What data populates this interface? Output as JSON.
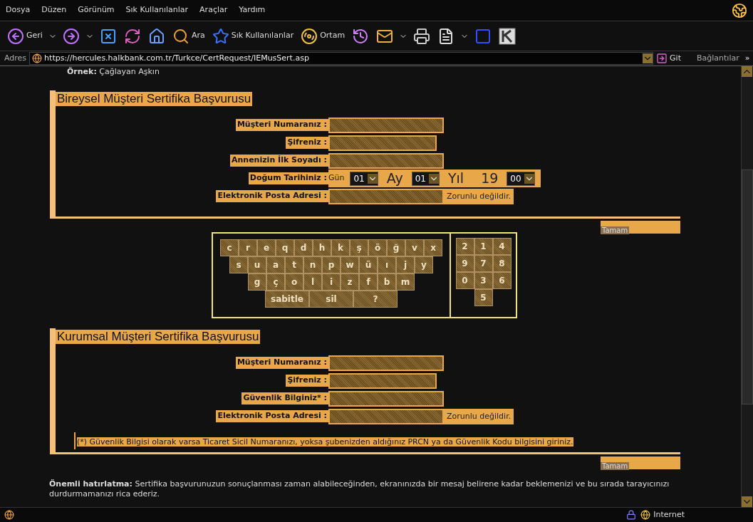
{
  "menu": [
    "Dosya",
    "Düzen",
    "Görünüm",
    "Sık Kullanılanlar",
    "Araçlar",
    "Yardım"
  ],
  "toolbar": [
    {
      "kind": "back",
      "label": "Geri",
      "dropdown": true
    },
    {
      "kind": "forward",
      "dropdown": true
    },
    {
      "kind": "stop"
    },
    {
      "kind": "refresh"
    },
    {
      "kind": "home"
    },
    {
      "kind": "search",
      "label": "Ara"
    },
    {
      "kind": "favorites",
      "label": "Sık Kullanılanlar"
    },
    {
      "kind": "media",
      "label": "Ortam"
    },
    {
      "kind": "history"
    },
    {
      "kind": "mail",
      "dropdown": true
    },
    {
      "kind": "print"
    },
    {
      "kind": "word",
      "dropdown": true
    },
    {
      "kind": "square"
    },
    {
      "kind": "k"
    }
  ],
  "address_bar": {
    "label": "Adres",
    "url": "https://hercules.halkbank.com.tr/Turkce/CertRequest/IEMusSert.asp",
    "go": "Git",
    "links": "Bağlantılar",
    "more": "»"
  },
  "example": "**Örnek:** Çağlayan Aşkın",
  "sections": [
    {
      "title": "Bireysel Müşteri Sertifika Başvurusu",
      "rows": [
        {
          "label": "Müşteri Numaranız :",
          "kind": "text"
        },
        {
          "label": "Şifreniz :",
          "kind": "password"
        },
        {
          "label": "Annenizin İlk Soyadı :",
          "kind": "text"
        },
        {
          "label": "Doğum Tarihiniz :",
          "kind": "date",
          "parts": [
            {
              "kind": "small",
              "text": "Gün"
            },
            {
              "kind": "select",
              "value": "01"
            },
            {
              "kind": "big",
              "text": "Ay"
            },
            {
              "kind": "select",
              "value": "01"
            },
            {
              "kind": "big",
              "text": "Yıl"
            },
            {
              "kind": "big",
              "text": "19"
            },
            {
              "kind": "select",
              "value": "00"
            }
          ]
        },
        {
          "label": "Elektronik Posta Adresi :",
          "kind": "text",
          "note": "Zorunlu değildir."
        }
      ],
      "submit": "Tamam"
    },
    {
      "title": "Kurumsal Müşteri Sertifika Başvurusu",
      "rows": [
        {
          "label": "Müşteri Numaranız :",
          "kind": "text"
        },
        {
          "label": "Şifreniz :",
          "kind": "password"
        },
        {
          "label": "Güvenlik Bilginiz* :",
          "kind": "text"
        },
        {
          "label": "Elektronik Posta Adresi :",
          "kind": "text",
          "note": "Zorunlu değildir."
        }
      ],
      "footnote": "(*) Güvenlik Bilgisi olarak varsa Ticaret Sicil Numaranızı, yoksa şubenizden aldığınız PRCN ya da Güvenlik Kodu bilgisini giriniz.",
      "submit": "Tamam"
    }
  ],
  "keyboard": {
    "letter_rows": [
      [
        "c",
        "r",
        "e",
        "q",
        "d",
        "h",
        "k",
        "ş",
        "ö",
        "ğ",
        "v",
        "x"
      ],
      [
        "s",
        "u",
        "a",
        "t",
        "n",
        "p",
        "w",
        "ü",
        "ı",
        "j",
        "y"
      ],
      [
        "g",
        "ç",
        "o",
        "l",
        "i",
        "z",
        "f",
        "b",
        "m"
      ],
      [
        "sabitle",
        "sil",
        "?"
      ]
    ],
    "number_rows": [
      [
        "2",
        "1",
        "4"
      ],
      [
        "9",
        "7",
        "8"
      ],
      [
        "0",
        "3",
        "6"
      ],
      [
        "5"
      ]
    ]
  },
  "reminder": "**Önemli hatırlatma:** Sertifika başvurunuzun sonuçlanması zaman alabileceğinden, ekranınızda bir mesaj belirene kadar beklemenizi ve bu sırada tarayıcınızı durdurmamanızı rica ederiz.",
  "status_bar": {
    "zone": "Internet"
  }
}
